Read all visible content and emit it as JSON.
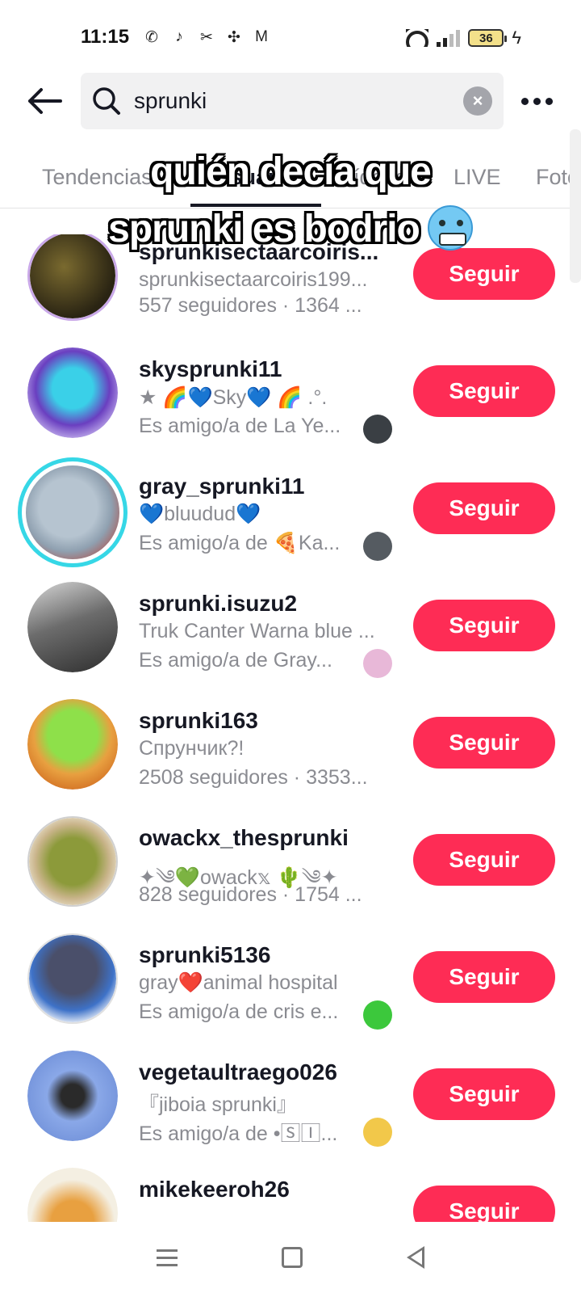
{
  "status_bar": {
    "time": "11:15",
    "battery": "36",
    "app_icons": [
      "whatsapp-icon",
      "tiktok-icon",
      "capcut-icon",
      "pinwheel-icon",
      "gmail-icon"
    ]
  },
  "search": {
    "query": "sprunki",
    "clear_icon": "×"
  },
  "tabs": [
    {
      "label": "Tendencias",
      "active": false
    },
    {
      "label": "Usuarios",
      "active": true
    },
    {
      "label": "Vídeos",
      "active": false
    },
    {
      "label": "LIVE",
      "active": false
    },
    {
      "label": "Fotos",
      "active": false
    }
  ],
  "caption": {
    "line1": "quién decía que",
    "line2": "sprunki es bodrio"
  },
  "follow_label": "Seguir",
  "users": [
    {
      "username": "sprunkisectaarcoiris...",
      "bio": "sprunkisectaarcoiris199...",
      "meta": "557 seguidores · 1364 ..."
    },
    {
      "username": "skysprunki11",
      "bio": "★ 🌈💙Sky💙 🌈 .°.",
      "meta": "Es amigo/a de La Ye..."
    },
    {
      "username": "gray_sprunki11",
      "bio": "💙bluudud💙",
      "meta": "Es amigo/a de 🍕Ka..."
    },
    {
      "username": "sprunki.isuzu2",
      "bio": "Truk Canter Warna blue ...",
      "meta": "Es amigo/a de Gray..."
    },
    {
      "username": "sprunki163",
      "bio": "Спрунчик?!",
      "meta": "2508 seguidores · 3353..."
    },
    {
      "username": "owackx_thesprunki",
      "bio": "✦༄💚owack𝕩 🌵༄✦",
      "meta": "828 seguidores · 1754 ..."
    },
    {
      "username": "sprunki5136",
      "bio": "gray❤️animal hospital",
      "meta": "Es amigo/a de cris e..."
    },
    {
      "username": "vegetaultraego026",
      "bio": "『jiboia sprunki』",
      "meta": "Es amigo/a de •🅂🄸..."
    },
    {
      "username": "mikekeeroh26",
      "bio": "",
      "meta": ""
    }
  ],
  "colors": {
    "follow_button": "#fe2c55",
    "active_tab": "#161823",
    "muted_text": "#8a8b91",
    "ring": "#36d7e6"
  }
}
